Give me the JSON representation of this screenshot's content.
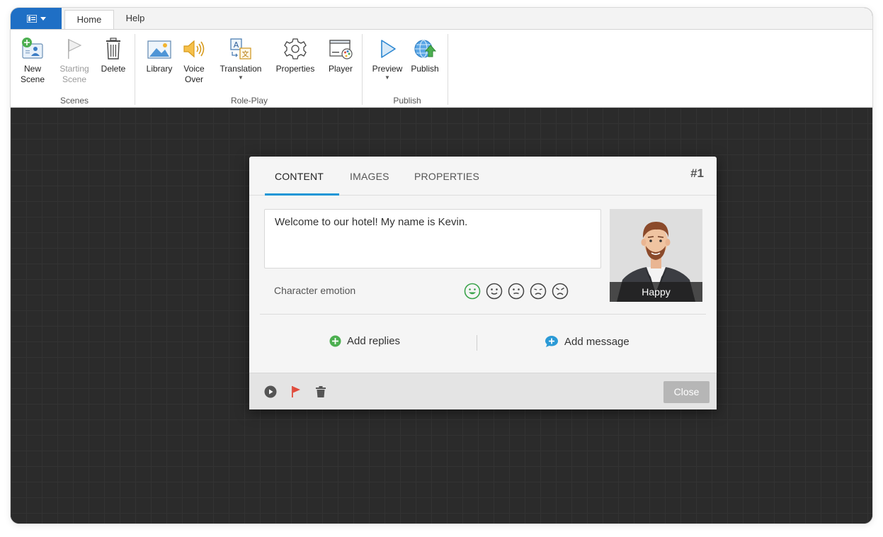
{
  "tabs": {
    "home": "Home",
    "help": "Help"
  },
  "ribbon": {
    "new_scene": "New\nScene",
    "starting_scene": "Starting\nScene",
    "delete": "Delete",
    "library": "Library",
    "voice_over": "Voice\nOver",
    "translation": "Translation",
    "properties": "Properties",
    "player": "Player",
    "preview": "Preview",
    "publish": "Publish",
    "groups": {
      "scenes": "Scenes",
      "role_play": "Role-Play",
      "publish": "Publish"
    }
  },
  "dialog": {
    "tabs": [
      "CONTENT",
      "IMAGES",
      "PROPERTIES"
    ],
    "active_tab": "CONTENT",
    "number": "#1",
    "message": "Welcome to our hotel! My name is Kevin.",
    "character_emotion_label": "Character emotion",
    "emotions": [
      "happy-icon",
      "neutral-smile-icon",
      "neutral-icon",
      "sad-icon",
      "angry-icon"
    ],
    "selected_emotion": "Happy",
    "add_replies": "Add replies",
    "add_message": "Add message",
    "close": "Close"
  },
  "colors": {
    "accent_blue": "#1f6fc5",
    "tab_underline": "#1a96d6",
    "emotion_selected": "#3aa34a",
    "add_replies_green": "#4caf50",
    "add_message_blue": "#2b9ad6",
    "flag_red": "#e04b3c"
  }
}
